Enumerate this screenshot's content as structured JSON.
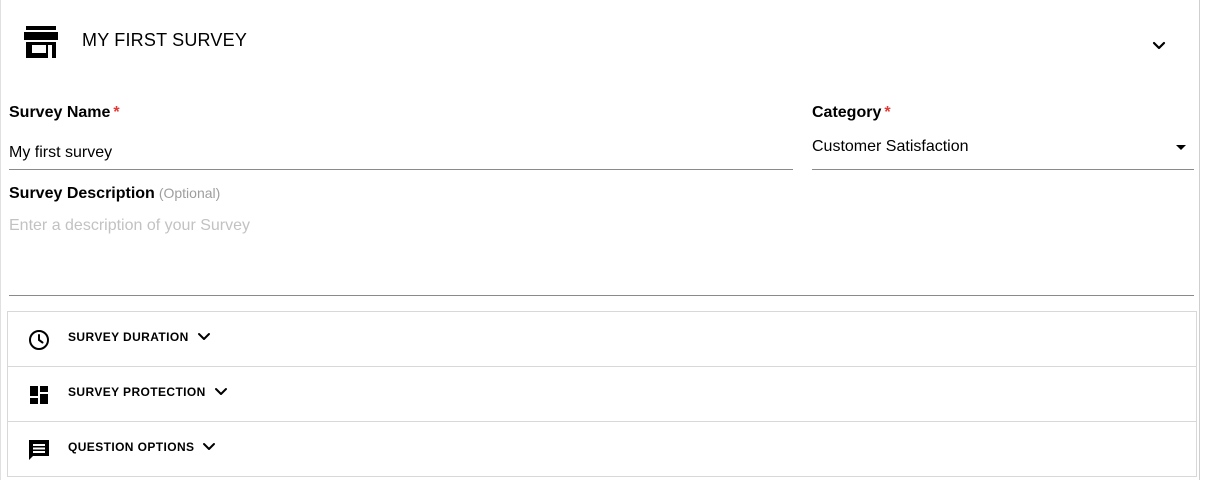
{
  "header": {
    "title": "MY FIRST SURVEY",
    "icon": "store-icon",
    "toggle_icon": "chevron-down-icon"
  },
  "form": {
    "survey_name": {
      "label": "Survey Name",
      "required_mark": "*",
      "value": "My first survey"
    },
    "category": {
      "label": "Category",
      "required_mark": "*",
      "selected": "Customer Satisfaction"
    },
    "description": {
      "label": "Survey Description",
      "optional_note": "(Optional)",
      "placeholder": "Enter a description of your Survey",
      "value": ""
    }
  },
  "sections": [
    {
      "label": "SURVEY DURATION",
      "icon": "clock-icon"
    },
    {
      "label": "SURVEY PROTECTION",
      "icon": "dashboard-icon"
    },
    {
      "label": "QUESTION OPTIONS",
      "icon": "comment-icon"
    }
  ],
  "colors": {
    "required": "#e53935",
    "placeholder": "#c2c2c2",
    "optional": "#9e9e9e"
  }
}
